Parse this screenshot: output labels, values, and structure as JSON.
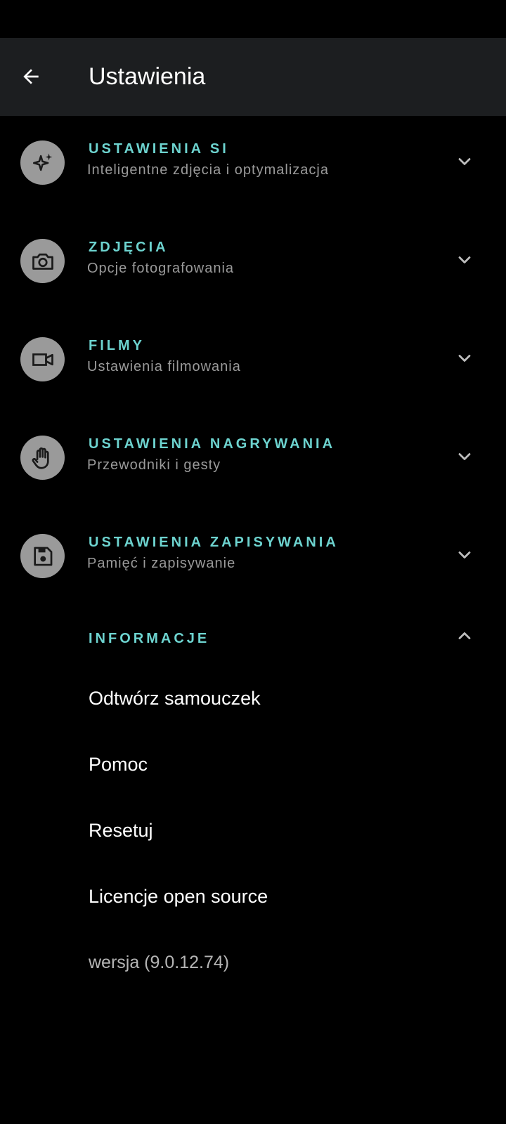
{
  "app_bar": {
    "title": "Ustawienia",
    "back_icon": "arrow-back-icon"
  },
  "sections": [
    {
      "title": "USTAWIENIA SI",
      "subtitle": "Inteligentne zdjęcia i optymalizacja",
      "icon": "sparkle-icon",
      "expanded": false
    },
    {
      "title": "ZDJĘCIA",
      "subtitle": "Opcje fotografowania",
      "icon": "camera-icon",
      "expanded": false
    },
    {
      "title": "FILMY",
      "subtitle": "Ustawienia filmowania",
      "icon": "video-camera-icon",
      "expanded": false
    },
    {
      "title": "USTAWIENIA NAGRYWANIA",
      "subtitle": "Przewodniki i gesty",
      "icon": "hand-icon",
      "expanded": false
    },
    {
      "title": "USTAWIENIA ZAPISYWANIA",
      "subtitle": "Pamięć i zapisywanie",
      "icon": "save-icon",
      "expanded": false
    }
  ],
  "info": {
    "title": "INFORMACJE",
    "expanded": true,
    "items": [
      {
        "label": "Odtwórz samouczek"
      },
      {
        "label": "Pomoc"
      },
      {
        "label": "Resetuj"
      },
      {
        "label": "Licencje open source"
      }
    ],
    "version": "wersja (9.0.12.74)"
  },
  "colors": {
    "accent": "#6dd3cf",
    "background": "#000000",
    "app_bar": "#1c1e20",
    "icon_circle": "#9a9a9a",
    "subtitle": "#9a9a9a"
  }
}
